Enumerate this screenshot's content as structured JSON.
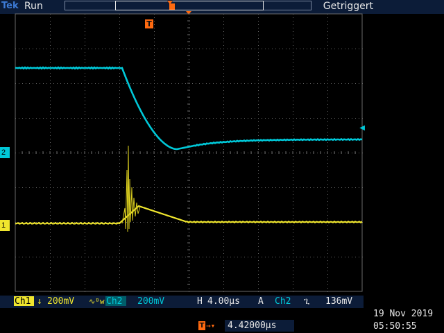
{
  "status": {
    "brand": "Tek",
    "run_state": "Run",
    "trigger_state": "Getriggert",
    "trigger_marker": "T"
  },
  "channels": {
    "ch1": {
      "label": "Ch1",
      "marker": "1",
      "coupling_icon": "arrow-down-icon",
      "scale": "200mV",
      "bw_icon": "bw-limit-icon",
      "color": "#f0e62e"
    },
    "ch2": {
      "label": "Ch2",
      "marker": "2",
      "scale": "200mV",
      "color": "#00c8d8"
    }
  },
  "timebase": {
    "label": "H",
    "value": "4.00µs"
  },
  "trigger": {
    "label": "A",
    "source": "Ch2",
    "slope_icon": "falling-edge-icon",
    "level": "136mV",
    "position_value": "4.42000µs"
  },
  "datetime": {
    "date": "19 Nov 2019",
    "time": "05:50:55"
  },
  "colors": {
    "background": "#000000",
    "panel": "#0c1c38",
    "trigger_orange": "#ff6a10",
    "grid": "#505050"
  }
}
